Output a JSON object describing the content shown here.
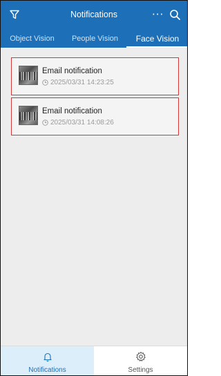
{
  "header": {
    "title": "Notifications",
    "more_label": "···",
    "filter_icon": "filter-icon",
    "search_icon": "search-icon"
  },
  "tabs": [
    {
      "label": "Object Vision",
      "active": false
    },
    {
      "label": "People Vision",
      "active": false
    },
    {
      "label": "Face Vision",
      "active": true
    }
  ],
  "notifications": [
    {
      "title": "Email notification",
      "time": "2025/03/31 14:23:25",
      "icon": "clock-icon"
    },
    {
      "title": "Email notification",
      "time": "2025/03/31 14:08:26",
      "icon": "clock-icon"
    }
  ],
  "bottom_nav": [
    {
      "label": "Notifications",
      "icon": "bell-icon",
      "active": true
    },
    {
      "label": "Settings",
      "icon": "gear-icon",
      "active": false
    }
  ],
  "colors": {
    "header": "#1d6fb8",
    "card_border": "#d23a3a",
    "active_nav_bg": "#dceefa",
    "background": "#ededed"
  }
}
